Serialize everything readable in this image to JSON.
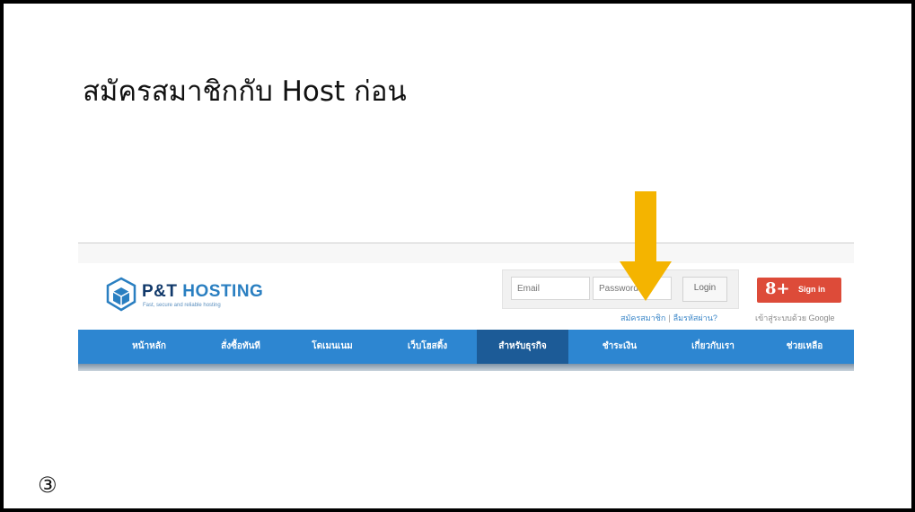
{
  "slide": {
    "title": "สมัครสมาชิกกับ Host ก่อน",
    "step": "③"
  },
  "site": {
    "logo_name_prefix": "P&T",
    "logo_name_suffix": "HOSTING",
    "logo_tagline": "Fast, secure and reliable hosting",
    "brand_color": "#2a7fc1",
    "nav_color": "#2d86d1",
    "arrow_color": "#f4b400",
    "login": {
      "email_placeholder": "Email",
      "password_placeholder": "Password",
      "login_label": "Login"
    },
    "links": {
      "register": "สมัครสมาชิก",
      "separator": "|",
      "forgot": "ลืมรหัสผ่าน?"
    },
    "google": {
      "plus": "8+",
      "sign_in": "Sign in",
      "caption": "เข้าสู่ระบบด้วย Google"
    },
    "nav": [
      {
        "label": "หน้าหลัก",
        "active": false
      },
      {
        "label": "สั่งซื้อทันที",
        "active": false
      },
      {
        "label": "โดเมนเนม",
        "active": false
      },
      {
        "label": "เว็บโฮสติ้ง",
        "active": false
      },
      {
        "label": "สำหรับธุรกิจ",
        "active": true
      },
      {
        "label": "ชำระเงิน",
        "active": false
      },
      {
        "label": "เกี่ยวกับเรา",
        "active": false
      },
      {
        "label": "ช่วยเหลือ",
        "active": false
      }
    ]
  }
}
